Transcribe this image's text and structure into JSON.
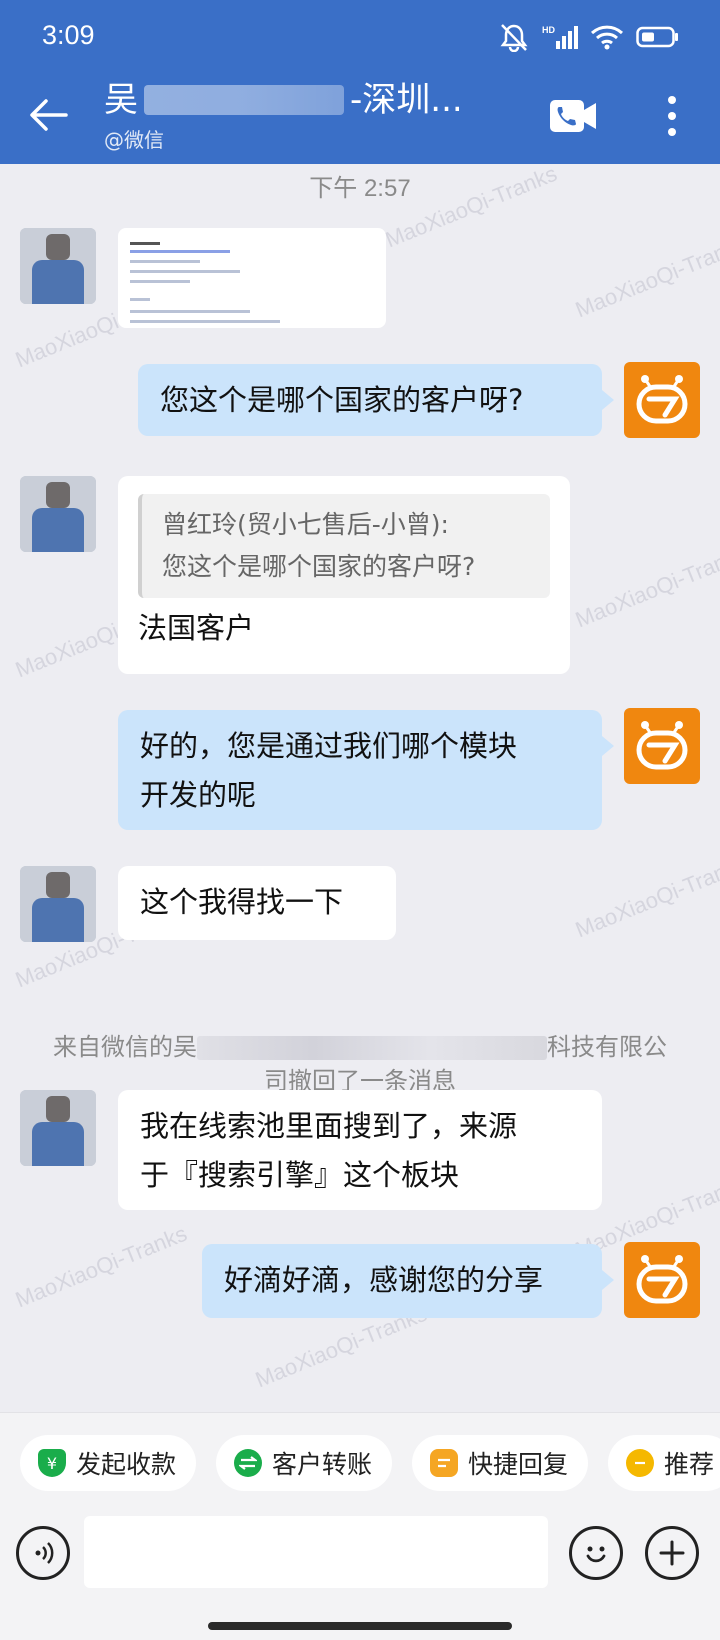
{
  "status_bar": {
    "time": "3:09"
  },
  "header": {
    "title_prefix": "吴",
    "title_suffix": "-深圳...",
    "subtitle": "@微信"
  },
  "chat": {
    "time_label": "下午 2:57",
    "messages": [
      {
        "type": "image",
        "direction": "in"
      },
      {
        "type": "text",
        "direction": "out",
        "text": "您这个是哪个国家的客户呀?"
      },
      {
        "type": "reply",
        "direction": "in",
        "quote_author": "曾红玲(贸小七售后-小曾):",
        "quote_text": "您这个是哪个国家的客户呀?",
        "text": "法国客户"
      },
      {
        "type": "text",
        "direction": "out",
        "lines": [
          "好的，您是通过我们哪个模块",
          "开发的呢"
        ]
      },
      {
        "type": "text",
        "direction": "in",
        "text": "这个我得找一下"
      },
      {
        "type": "text",
        "direction": "in",
        "lines": [
          "我在线索池里面搜到了，来源",
          "于『搜索引擎』这个板块"
        ]
      },
      {
        "type": "text",
        "direction": "out",
        "text": "好滴好滴，感谢您的分享"
      }
    ],
    "recall_notice": {
      "prefix": "来自微信的吴",
      "suffix": "科技有限公",
      "line2": "司撤回了一条消息"
    },
    "watermark": "MaoXiaoQi-Tranks"
  },
  "quick_actions": [
    {
      "label": "发起收款",
      "icon": "shield-yen-icon",
      "color": "#1aad4b"
    },
    {
      "label": "客户转账",
      "icon": "transfer-icon",
      "color": "#1aad4b"
    },
    {
      "label": "快捷回复",
      "icon": "quick-reply-icon",
      "color": "#f5a623"
    },
    {
      "label": "推荐",
      "icon": "recommend-icon",
      "color": "#f5b800"
    }
  ],
  "input": {
    "placeholder": ""
  },
  "colors": {
    "header": "#3a6fc7",
    "bot_avatar": "#f0870f",
    "out_bubble": "#cbe4fb"
  }
}
